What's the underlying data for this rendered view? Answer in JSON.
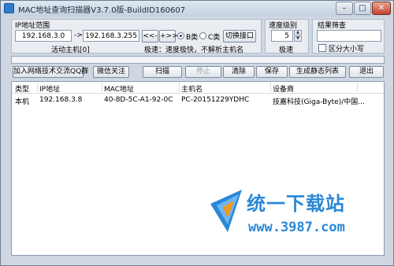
{
  "window": {
    "title": "MAC地址查询扫描器V3.7.0版-BuildID160607",
    "min_label": "–",
    "max_label": "□",
    "close_label": "✕"
  },
  "ip_range": {
    "group_label": "IP地址范围",
    "start_ip": "192.168.3.0",
    "arrow": "->",
    "end_ip": "192.168.3.255",
    "prev_btn": "<<-",
    "next_btn": "+>>",
    "class_b_label": "B类",
    "class_c_label": "C类",
    "switch_btn": "切换接口",
    "active_hosts": "活动主机[0]",
    "speed_hint": "极速：速度极快，不解析主机名",
    "selected_class": "B"
  },
  "speed": {
    "group_label": "速度级别",
    "value": "5",
    "caption": "极速"
  },
  "filter": {
    "group_label": "结果筛查",
    "value": "",
    "case_label": "区分大小写",
    "case_checked": false
  },
  "progress": {
    "fraction": 0
  },
  "toolbar": {
    "join_qq": "加入网络技术交流QQ群",
    "wechat": "微信关注",
    "scan": "扫描",
    "stop": "停止",
    "clear": "清除",
    "save": "保存",
    "gen_static": "生成静态列表",
    "exit": "退出"
  },
  "table": {
    "columns": [
      "类型",
      "IP地址",
      "MAC地址",
      "主机名",
      "设备商"
    ],
    "rows": [
      [
        "本机",
        "192.168.3.8",
        "40-8D-5C-A1-92-0C",
        "PC-20151229YDHC",
        "技嘉科技(Giga-Byte)/中国..."
      ]
    ]
  },
  "watermark": {
    "text": "统一下载站",
    "url": "www.3987.com"
  },
  "colors": {
    "accent": "#2a88d6",
    "window_bg": "#ced7e2"
  }
}
